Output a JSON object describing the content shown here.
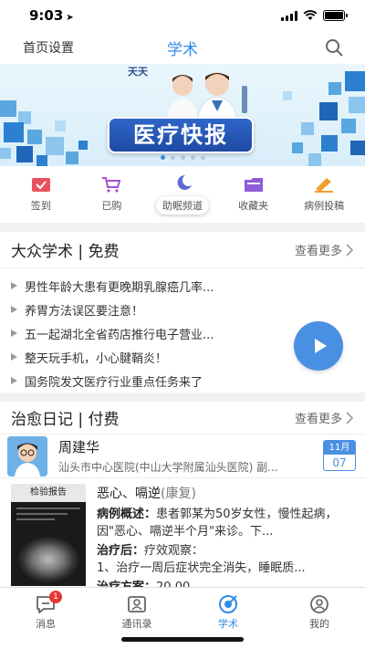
{
  "status": {
    "time": "9:03"
  },
  "nav": {
    "left": "首页设置",
    "title": "学术"
  },
  "banner": {
    "logo_line1": "天天",
    "logo_line2": "医路人 健康 一路行",
    "headline": "医疗快报",
    "slides": 5,
    "active_slide": 1
  },
  "quick": [
    {
      "label": "签到",
      "icon": "checkin-icon"
    },
    {
      "label": "已购",
      "icon": "cart-icon"
    },
    {
      "label": "助眠频道",
      "icon": "moon-icon"
    },
    {
      "label": "收藏夹",
      "icon": "folder-icon"
    },
    {
      "label": "病例投稿",
      "icon": "submit-case-icon"
    }
  ],
  "public": {
    "title": "大众学术 | 免费",
    "more": "查看更多",
    "items": [
      "男性年龄大患有更晚期乳腺癌几率...",
      "养胃方法误区要注意！",
      "五一起湖北全省药店推行电子营业...",
      "整天玩手机，小心腱鞘炎！",
      "国务院发文医疗行业重点任务来了"
    ]
  },
  "paid": {
    "title": "治愈日记 | 付费",
    "more": "查看更多",
    "author": {
      "name": "周建华",
      "org": "汕头市中心医院(中山大学附属汕头医院)  副...",
      "month": "11月",
      "day": "07"
    },
    "case": {
      "thumb_label": "检验报告",
      "title": "恶心、嗝逆",
      "tag": "(康复)",
      "summary_label": "病例概述：",
      "summary": "患者郭某为50岁女性，慢性起病，因\"恶心、嗝逆半个月\"来诊。下...",
      "after_label": "治疗后：",
      "after": "疗效观察：",
      "after2": "1、治疗一周后症状完全消失，睡眠质...",
      "plan_label": "治疗方案：",
      "plan": "20.00"
    }
  },
  "tabs": [
    {
      "label": "消息",
      "badge": "1"
    },
    {
      "label": "通讯录"
    },
    {
      "label": "学术"
    },
    {
      "label": "我的"
    }
  ],
  "colors": {
    "accent": "#2f8be6",
    "badge": "#e53935"
  }
}
